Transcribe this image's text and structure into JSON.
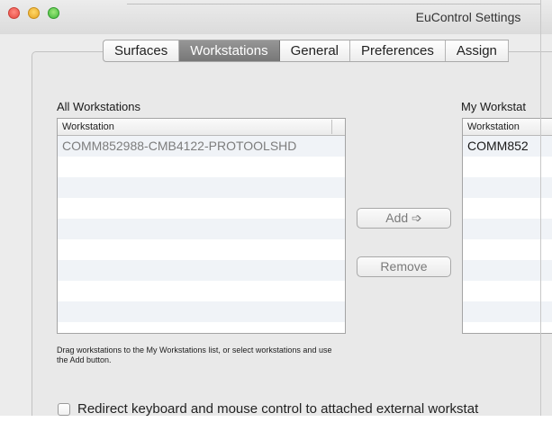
{
  "window": {
    "title": "EuControl Settings"
  },
  "tabs": [
    {
      "label": "Surfaces",
      "active": false
    },
    {
      "label": "Workstations",
      "active": true
    },
    {
      "label": "General",
      "active": false
    },
    {
      "label": "Preferences",
      "active": false
    },
    {
      "label": "Assign",
      "active": false
    }
  ],
  "all_workstations": {
    "label": "All Workstations",
    "column_header": "Workstation",
    "rows": [
      "COMM852988-CMB4122-PROTOOLSHD",
      "",
      "",
      "",
      "",
      "",
      "",
      "",
      "",
      ""
    ]
  },
  "my_workstations": {
    "label": "My Workstat",
    "column_header": "Workstation",
    "rows": [
      "COMM852",
      "",
      "",
      "",
      "",
      "",
      "",
      "",
      "",
      ""
    ]
  },
  "buttons": {
    "add": "Add ➩",
    "remove": "Remove"
  },
  "hint": "Drag workstations to the My Workstations list, or select workstations and use the Add button.",
  "redirect_option": {
    "label": "Redirect keyboard and mouse control to attached external workstat",
    "checked": false
  },
  "colors": {
    "active_tab": "#888888",
    "window_bg": "#ececec",
    "row_stripe": "#f0f3f7"
  }
}
